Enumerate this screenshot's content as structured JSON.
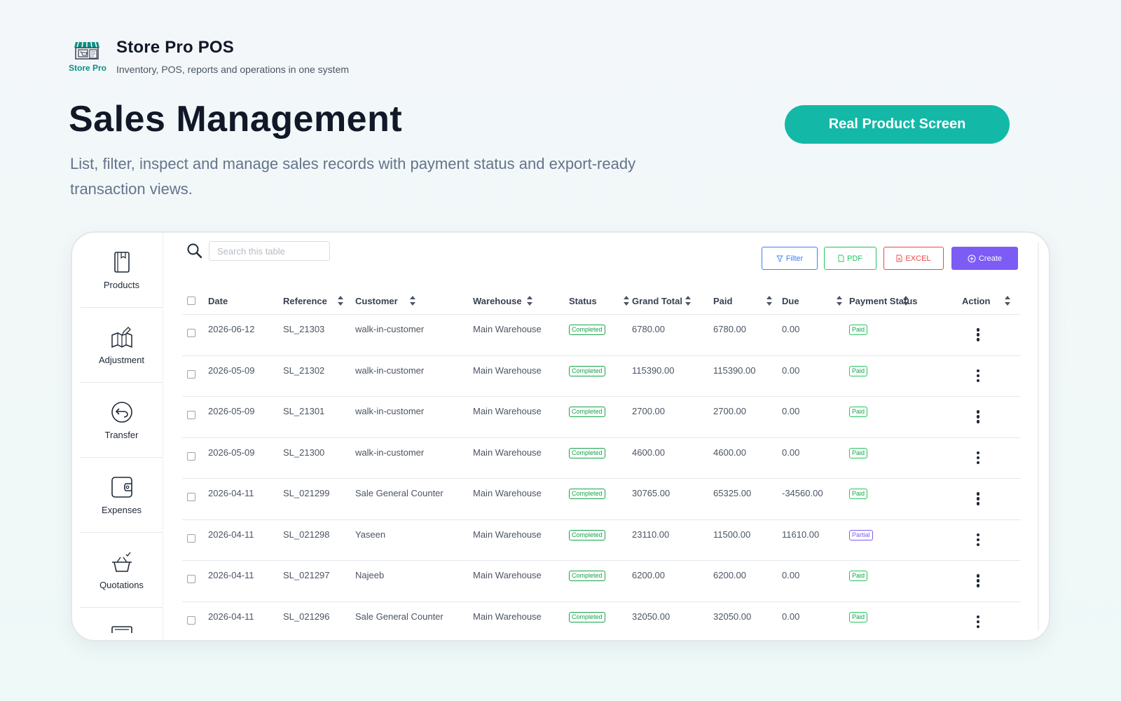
{
  "brand": {
    "logo_text": "Store Pro",
    "title": "Store Pro POS",
    "subtitle": "Inventory, POS, reports and operations in one system"
  },
  "hero": {
    "title": "Sales Management",
    "description": "List, filter, inspect and manage sales records with payment status and export-ready transaction views.",
    "button_label": "Real Product Screen"
  },
  "sidebar": {
    "items": [
      {
        "label": "Products",
        "icon": "book-icon"
      },
      {
        "label": "Adjustment",
        "icon": "map-edit-icon"
      },
      {
        "label": "Transfer",
        "icon": "return-arrow-icon"
      },
      {
        "label": "Expenses",
        "icon": "wallet-icon"
      },
      {
        "label": "Quotations",
        "icon": "basket-check-icon"
      }
    ]
  },
  "toolbar": {
    "search_placeholder": "Search this table",
    "filter_label": "Filter",
    "pdf_label": "PDF",
    "excel_label": "EXCEL",
    "create_label": "Create"
  },
  "table": {
    "columns": [
      "Date",
      "Reference",
      "Customer",
      "Warehouse",
      "Status",
      "Grand Total",
      "Paid",
      "Due",
      "Payment Status",
      "Action"
    ],
    "rows": [
      {
        "date": "2026-06-12",
        "reference": "SL_21303",
        "customer": "walk-in-customer",
        "warehouse": "Main Warehouse",
        "status": "Completed",
        "grand_total": "6780.00",
        "paid": "6780.00",
        "due": "0.00",
        "payment_status": "Paid"
      },
      {
        "date": "2026-05-09",
        "reference": "SL_21302",
        "customer": "walk-in-customer",
        "warehouse": "Main Warehouse",
        "status": "Completed",
        "grand_total": "115390.00",
        "paid": "115390.00",
        "due": "0.00",
        "payment_status": "Paid"
      },
      {
        "date": "2026-05-09",
        "reference": "SL_21301",
        "customer": "walk-in-customer",
        "warehouse": "Main Warehouse",
        "status": "Completed",
        "grand_total": "2700.00",
        "paid": "2700.00",
        "due": "0.00",
        "payment_status": "Paid"
      },
      {
        "date": "2026-05-09",
        "reference": "SL_21300",
        "customer": "walk-in-customer",
        "warehouse": "Main Warehouse",
        "status": "Completed",
        "grand_total": "4600.00",
        "paid": "4600.00",
        "due": "0.00",
        "payment_status": "Paid"
      },
      {
        "date": "2026-04-11",
        "reference": "SL_021299",
        "customer": "Sale General Counter",
        "warehouse": "Main Warehouse",
        "status": "Completed",
        "grand_total": "30765.00",
        "paid": "65325.00",
        "due": "-34560.00",
        "payment_status": "Paid"
      },
      {
        "date": "2026-04-11",
        "reference": "SL_021298",
        "customer": "Yaseen",
        "warehouse": "Main Warehouse",
        "status": "Completed",
        "grand_total": "23110.00",
        "paid": "11500.00",
        "due": "11610.00",
        "payment_status": "Partial"
      },
      {
        "date": "2026-04-11",
        "reference": "SL_021297",
        "customer": "Najeeb",
        "warehouse": "Main Warehouse",
        "status": "Completed",
        "grand_total": "6200.00",
        "paid": "6200.00",
        "due": "0.00",
        "payment_status": "Paid"
      },
      {
        "date": "2026-04-11",
        "reference": "SL_021296",
        "customer": "Sale General Counter",
        "warehouse": "Main Warehouse",
        "status": "Completed",
        "grand_total": "32050.00",
        "paid": "32050.00",
        "due": "0.00",
        "payment_status": "Paid"
      }
    ]
  },
  "colors": {
    "accent_teal": "#14b8a6",
    "create_purple": "#7c5cf5",
    "filter_blue": "#3b82f6",
    "pdf_green": "#22c55e",
    "excel_red": "#ef4444",
    "paid_green": "#16a34a",
    "partial_purple": "#7c5cf5"
  }
}
